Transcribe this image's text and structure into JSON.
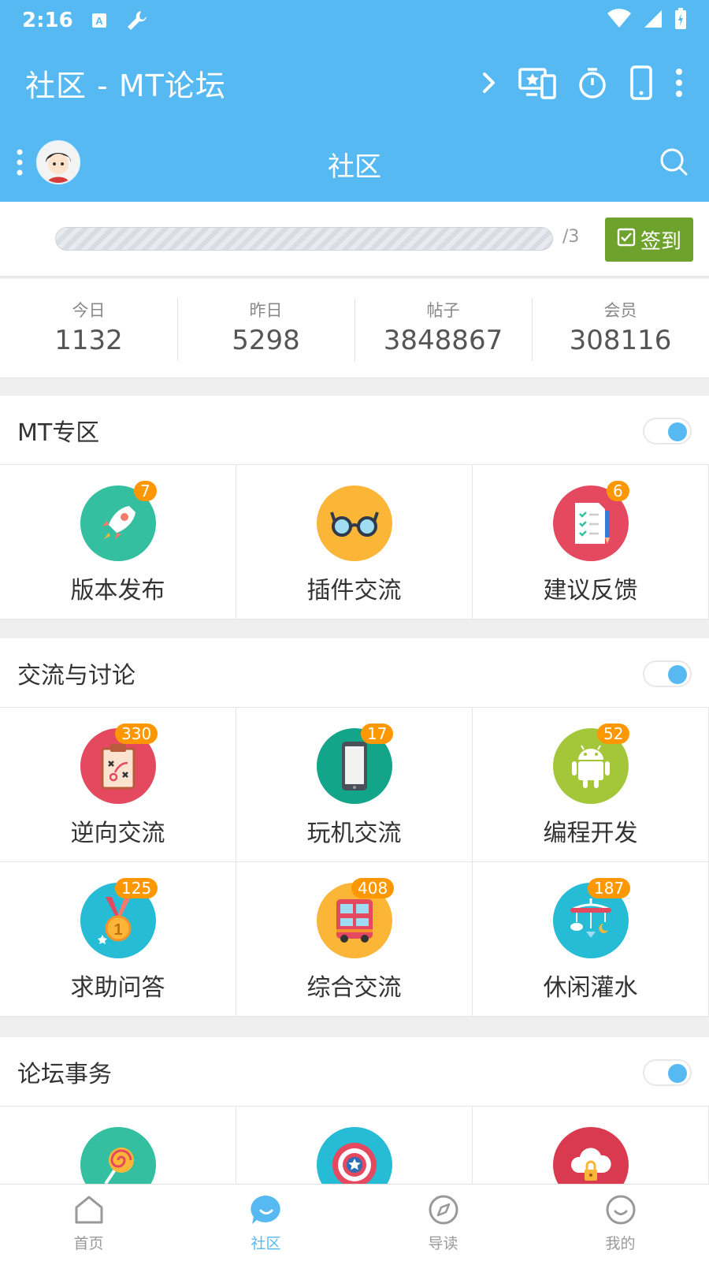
{
  "status_bar": {
    "time": "2:16"
  },
  "app_bar": {
    "title": "社区 - MT论坛"
  },
  "sub_bar": {
    "title": "社区"
  },
  "sign": {
    "progress_label": "/3",
    "button_label": "签到",
    "progress_fraction": 0
  },
  "stats": [
    {
      "label": "今日",
      "value": "1132"
    },
    {
      "label": "昨日",
      "value": "5298"
    },
    {
      "label": "帖子",
      "value": "3848867"
    },
    {
      "label": "会员",
      "value": "308116"
    }
  ],
  "sections": [
    {
      "title": "MT专区",
      "items": [
        {
          "label": "版本发布",
          "badge": "7",
          "color": "#34c0a0",
          "icon": "rocket-icon"
        },
        {
          "label": "插件交流",
          "badge": "",
          "color": "#fbb637",
          "icon": "glasses-icon"
        },
        {
          "label": "建议反馈",
          "badge": "6",
          "color": "#e5495f",
          "icon": "checklist-icon"
        }
      ]
    },
    {
      "title": "交流与讨论",
      "items": [
        {
          "label": "逆向交流",
          "badge": "330",
          "color": "#e5495f",
          "icon": "clipboard-icon"
        },
        {
          "label": "玩机交流",
          "badge": "17",
          "color": "#12a58a",
          "icon": "phone-icon"
        },
        {
          "label": "编程开发",
          "badge": "52",
          "color": "#a4c639",
          "icon": "android-icon"
        },
        {
          "label": "求助问答",
          "badge": "125",
          "color": "#27bcd6",
          "icon": "medal-icon"
        },
        {
          "label": "综合交流",
          "badge": "408",
          "color": "#fbb637",
          "icon": "bus-icon"
        },
        {
          "label": "休闲灌水",
          "badge": "187",
          "color": "#27bcd6",
          "icon": "mobile-toy-icon"
        }
      ]
    },
    {
      "title": "论坛事务",
      "items": [
        {
          "label": "",
          "badge": "",
          "color": "#34c0a0",
          "icon": "lollipop-icon"
        },
        {
          "label": "",
          "badge": "",
          "color": "#27bcd6",
          "icon": "shield-icon"
        },
        {
          "label": "",
          "badge": "",
          "color": "#d93a4f",
          "icon": "cloud-lock-icon"
        }
      ]
    }
  ],
  "bottom_nav": [
    {
      "label": "首页",
      "icon": "home-icon",
      "active": false
    },
    {
      "label": "社区",
      "icon": "community-icon",
      "active": true
    },
    {
      "label": "导读",
      "icon": "compass-icon",
      "active": false
    },
    {
      "label": "我的",
      "icon": "profile-icon",
      "active": false
    }
  ],
  "colors": {
    "primary": "#56b9f2",
    "sign_button": "#6da32c",
    "badge": "#ff9800"
  }
}
